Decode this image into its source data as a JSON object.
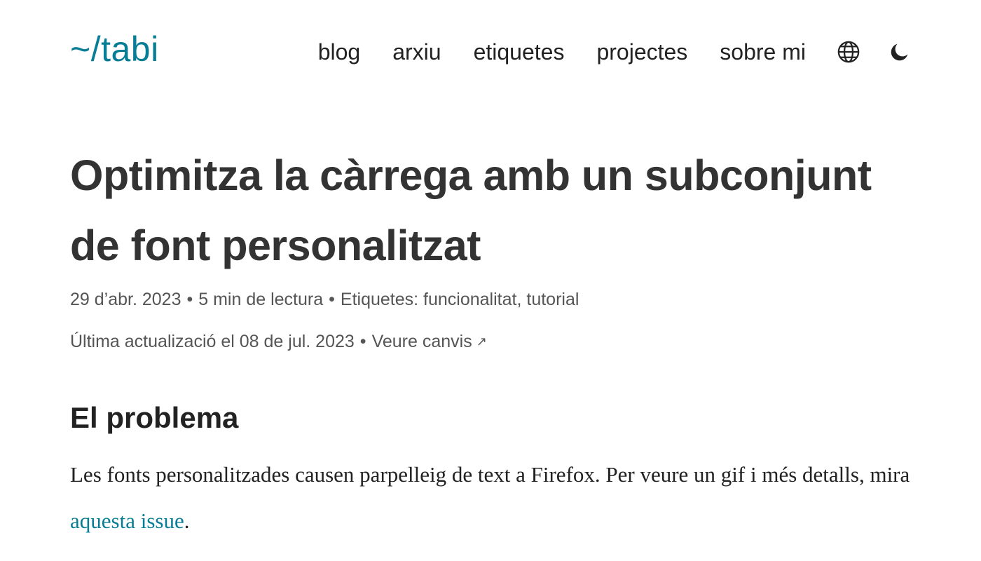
{
  "header": {
    "logo": "~/tabi",
    "nav": [
      "blog",
      "arxiu",
      "etiquetes",
      "projectes",
      "sobre mi"
    ],
    "icons": [
      "globe-icon",
      "moon-icon"
    ],
    "accent_color": "#087e96"
  },
  "article": {
    "title": "Optimitza la càrrega amb un subconjunt de font personalitzat",
    "date": "29 d’abr. 2023",
    "reading_time": "5 min de lectura",
    "tags_label": "Etiquetes:",
    "tags": [
      "funcionalitat",
      "tutorial"
    ],
    "updated": "Última actualizació el 08 de jul. 2023",
    "changes_link": "Veure canvis",
    "changes_arrow": "↗",
    "section_heading": "El problema",
    "paragraph_before_link": "Les fonts personalitzades causen parpelleig de text a Firefox. Per veure un gif i més detalls, mira ",
    "paragraph_link": "aquesta issue",
    "paragraph_after_link": ".",
    "separator": "•",
    "tag_separator": ","
  }
}
